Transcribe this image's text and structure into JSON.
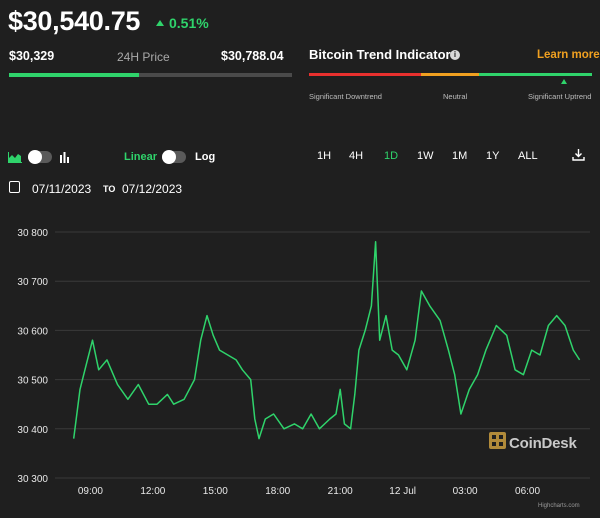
{
  "header": {
    "price": "$30,540.75",
    "change": "0.51%",
    "low": "$30,329",
    "range_label": "24H Price",
    "high": "$30,788.04",
    "range_position": 0.46
  },
  "trend": {
    "title": "Bitcoin Trend Indicator",
    "learn_more": "Learn more",
    "labels": [
      "Significant Downtrend",
      "Neutral",
      "Significant Uptrend"
    ],
    "colors": [
      "#e8302e",
      "#f0a020",
      "#2fd36b"
    ]
  },
  "controls": {
    "linear_label": "Linear",
    "log_label": "Log",
    "ranges": [
      "1H",
      "4H",
      "1D",
      "1W",
      "1M",
      "1Y",
      "ALL"
    ],
    "active_range": "1D",
    "area_icon": "area-chart-icon",
    "bar_icon": "bar-chart-icon",
    "download_icon": "download-icon"
  },
  "dates": {
    "from": "07/11/2023",
    "to_label": "TO",
    "to": "07/12/2023",
    "calendar_icon": "calendar-icon"
  },
  "chart_data": {
    "type": "line",
    "y_ticks": [
      "30 800",
      "30 700",
      "30 600",
      "30 500",
      "30 400",
      "30 300"
    ],
    "ylim": [
      30300,
      30800
    ],
    "x_ticks": [
      "09:00",
      "12:00",
      "15:00",
      "18:00",
      "21:00",
      "12 Jul",
      "03:00",
      "06:00"
    ],
    "series": [
      {
        "color": "#2fd36b",
        "values": [
          {
            "t": 8.2,
            "v": 30380
          },
          {
            "t": 8.5,
            "v": 30480
          },
          {
            "t": 8.8,
            "v": 30530
          },
          {
            "t": 9.1,
            "v": 30580
          },
          {
            "t": 9.4,
            "v": 30520
          },
          {
            "t": 9.8,
            "v": 30540
          },
          {
            "t": 10.3,
            "v": 30490
          },
          {
            "t": 10.8,
            "v": 30460
          },
          {
            "t": 11.3,
            "v": 30490
          },
          {
            "t": 11.8,
            "v": 30450
          },
          {
            "t": 12.2,
            "v": 30450
          },
          {
            "t": 12.7,
            "v": 30470
          },
          {
            "t": 13.0,
            "v": 30450
          },
          {
            "t": 13.5,
            "v": 30460
          },
          {
            "t": 14.0,
            "v": 30500
          },
          {
            "t": 14.3,
            "v": 30580
          },
          {
            "t": 14.6,
            "v": 30630
          },
          {
            "t": 14.9,
            "v": 30590
          },
          {
            "t": 15.2,
            "v": 30560
          },
          {
            "t": 15.6,
            "v": 30550
          },
          {
            "t": 16.0,
            "v": 30540
          },
          {
            "t": 16.3,
            "v": 30520
          },
          {
            "t": 16.7,
            "v": 30500
          },
          {
            "t": 16.9,
            "v": 30420
          },
          {
            "t": 17.1,
            "v": 30380
          },
          {
            "t": 17.4,
            "v": 30420
          },
          {
            "t": 17.8,
            "v": 30430
          },
          {
            "t": 18.3,
            "v": 30400
          },
          {
            "t": 18.8,
            "v": 30410
          },
          {
            "t": 19.2,
            "v": 30400
          },
          {
            "t": 19.6,
            "v": 30430
          },
          {
            "t": 20.0,
            "v": 30400
          },
          {
            "t": 20.5,
            "v": 30420
          },
          {
            "t": 20.8,
            "v": 30430
          },
          {
            "t": 21.0,
            "v": 30480
          },
          {
            "t": 21.2,
            "v": 30410
          },
          {
            "t": 21.5,
            "v": 30400
          },
          {
            "t": 21.7,
            "v": 30470
          },
          {
            "t": 21.9,
            "v": 30560
          },
          {
            "t": 22.2,
            "v": 30600
          },
          {
            "t": 22.5,
            "v": 30650
          },
          {
            "t": 22.7,
            "v": 30780
          },
          {
            "t": 22.9,
            "v": 30580
          },
          {
            "t": 23.2,
            "v": 30630
          },
          {
            "t": 23.5,
            "v": 30560
          },
          {
            "t": 23.8,
            "v": 30550
          },
          {
            "t": 24.2,
            "v": 30520
          },
          {
            "t": 24.6,
            "v": 30580
          },
          {
            "t": 24.9,
            "v": 30680
          },
          {
            "t": 25.3,
            "v": 30650
          },
          {
            "t": 25.8,
            "v": 30620
          },
          {
            "t": 26.2,
            "v": 30560
          },
          {
            "t": 26.5,
            "v": 30510
          },
          {
            "t": 26.8,
            "v": 30430
          },
          {
            "t": 27.2,
            "v": 30480
          },
          {
            "t": 27.6,
            "v": 30510
          },
          {
            "t": 28.0,
            "v": 30560
          },
          {
            "t": 28.5,
            "v": 30610
          },
          {
            "t": 29.0,
            "v": 30590
          },
          {
            "t": 29.4,
            "v": 30520
          },
          {
            "t": 29.8,
            "v": 30510
          },
          {
            "t": 30.2,
            "v": 30560
          },
          {
            "t": 30.6,
            "v": 30550
          },
          {
            "t": 31.0,
            "v": 30610
          },
          {
            "t": 31.4,
            "v": 30630
          },
          {
            "t": 31.8,
            "v": 30610
          },
          {
            "t": 32.2,
            "v": 30560
          },
          {
            "t": 32.5,
            "v": 30540
          }
        ]
      }
    ],
    "credit": "Highcharts.com",
    "watermark": "CoinDesk"
  }
}
